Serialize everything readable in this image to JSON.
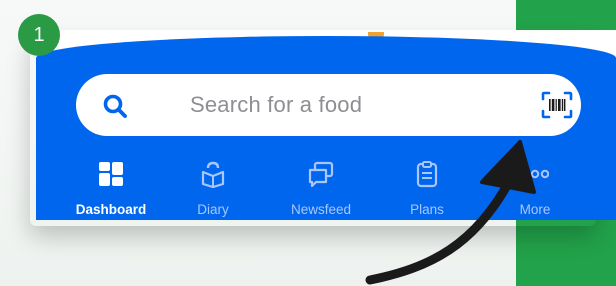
{
  "step_badge": "1",
  "search": {
    "placeholder": "Search for a food"
  },
  "nav": {
    "items": [
      {
        "label": "Dashboard",
        "icon": "dashboard-icon",
        "active": true
      },
      {
        "label": "Diary",
        "icon": "diary-icon",
        "active": false
      },
      {
        "label": "Newsfeed",
        "icon": "newsfeed-icon",
        "active": false
      },
      {
        "label": "Plans",
        "icon": "plans-icon",
        "active": false
      },
      {
        "label": "More",
        "icon": "more-icon",
        "active": false
      }
    ]
  },
  "colors": {
    "brand_blue": "#0066ee",
    "accent_green": "#22a24a",
    "arrow": "#1a1a1a"
  }
}
